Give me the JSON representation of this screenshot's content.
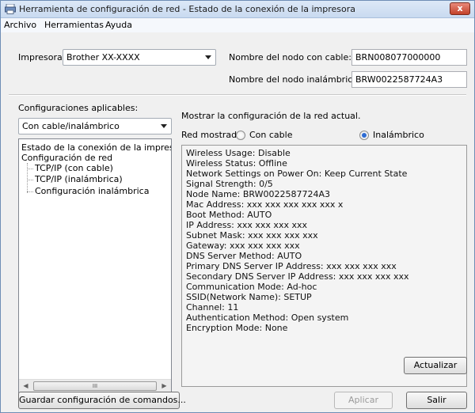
{
  "window": {
    "title": "Herramienta de configuración de red - Estado de la conexión de la impresora"
  },
  "menu": [
    "Archivo",
    "Herramientas",
    "Ayuda"
  ],
  "printer": {
    "label": "Impresora:",
    "value": "Brother XX-XXXX"
  },
  "wired_node": {
    "label": "Nombre del nodo con cable:",
    "value": "BRN008077000000"
  },
  "wireless_node": {
    "label": "Nombre del nodo inalámbrico:",
    "value": "BRW0022587724A3"
  },
  "settings": {
    "label": "Configuraciones aplicables:",
    "value": "Con cable/inalámbrico"
  },
  "tree": [
    "Estado de la conexión de la impreso",
    "Configuración de red",
    "TCP/IP (con cable)",
    "TCP/IP (inalámbrica)",
    "Configuración inalámbrica"
  ],
  "main": {
    "heading": "Mostrar la configuración de la red actual.",
    "network_label": "Red mostrada:",
    "radio_wired": "Con cable",
    "radio_wireless": "Inalámbrico"
  },
  "info_lines": [
    "Wireless Usage: Disable",
    "Wireless Status: Offline",
    "Network Settings on Power On: Keep Current State",
    "Signal Strength: 0/5",
    "Node Name: BRW0022587724A3",
    "Mac Address: xxx xxx xxx xxx xxx x",
    "Boot Method: AUTO",
    "IP Address: xxx xxx xxx xxx",
    "Subnet Mask: xxx xxx xxx xxx",
    "Gateway: xxx xxx xxx xxx",
    "DNS Server Method: AUTO",
    "Primary DNS Server IP Address: xxx xxx xxx xxx",
    "Secondary DNS Server IP Address: xxx xxx xxx xxx",
    "Communication Mode: Ad-hoc",
    "SSID(Network Name): SETUP",
    "Channel: 11",
    "Authentication Method: Open system",
    "Encryption Mode: None"
  ],
  "buttons": {
    "refresh": "Actualizar",
    "save_commands": "Guardar configuración de comandos...",
    "apply": "Aplicar",
    "exit": "Salir"
  },
  "scroll_glyph": "III",
  "close_glyph": "x"
}
